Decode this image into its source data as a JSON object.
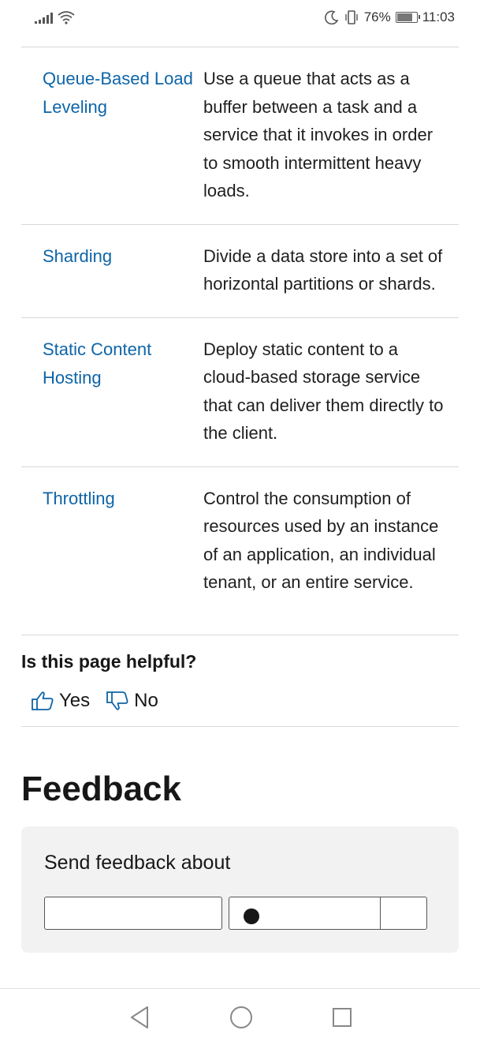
{
  "status": {
    "battery_percent": "76%",
    "battery_level": 0.76,
    "time": "11:03"
  },
  "patterns": [
    {
      "name": "Queue-Based Load Leveling",
      "description": "Use a queue that acts as a buffer between a task and a service that it invokes in order to smooth intermittent heavy loads."
    },
    {
      "name": "Sharding",
      "description": "Divide a data store into a set of horizontal partitions or shards."
    },
    {
      "name": "Static Content Hosting",
      "description": "Deploy static content to a cloud-based storage service that can deliver them directly to the client."
    },
    {
      "name": "Throttling",
      "description": "Control the consumption of resources used by an instance of an application, an individual tenant, or an entire service."
    }
  ],
  "helpful": {
    "question": "Is this page helpful?",
    "yes_label": "Yes",
    "no_label": "No"
  },
  "feedback": {
    "title": "Feedback",
    "send_about_label": "Send feedback about"
  },
  "colors": {
    "link": "#0e65a8",
    "text": "#171717",
    "panel": "#f2f2f2"
  }
}
